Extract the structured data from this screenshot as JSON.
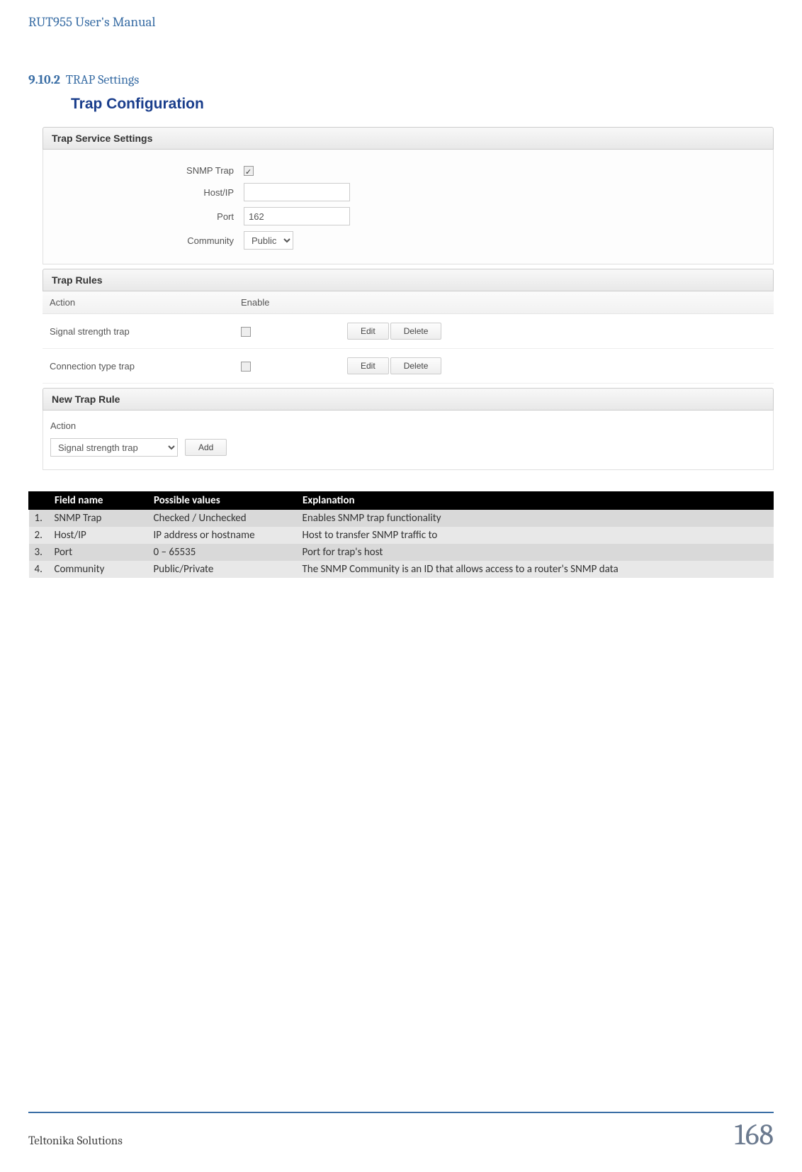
{
  "doc_title": "RUT955 User's Manual",
  "section": {
    "num": "9.10.2",
    "title": "TRAP Settings"
  },
  "ui": {
    "title": "Trap Configuration",
    "service_panel": {
      "header": "Trap Service Settings",
      "rows": {
        "snmp_trap_label": "SNMP Trap",
        "snmp_trap_checked": true,
        "host_label": "Host/IP",
        "host_value": "",
        "port_label": "Port",
        "port_value": "162",
        "community_label": "Community",
        "community_value": "Public"
      }
    },
    "rules_panel": {
      "header": "Trap Rules",
      "col_action": "Action",
      "col_enable": "Enable",
      "rows": [
        {
          "name": "Signal strength trap",
          "edit": "Edit",
          "delete": "Delete"
        },
        {
          "name": "Connection type trap",
          "edit": "Edit",
          "delete": "Delete"
        }
      ]
    },
    "new_rule": {
      "header": "New Trap Rule",
      "col_action": "Action",
      "select_value": "Signal strength trap",
      "add_label": "Add"
    }
  },
  "table": {
    "headers": {
      "num": "",
      "field": "Field name",
      "values": "Possible values",
      "expl": "Explanation"
    },
    "rows": [
      {
        "n": "1.",
        "f": "SNMP Trap",
        "v": "Checked / Unchecked",
        "e": "Enables SNMP trap functionality"
      },
      {
        "n": "2.",
        "f": "Host/IP",
        "v": "IP address or hostname",
        "e": "Host to transfer SNMP traffic to"
      },
      {
        "n": "3.",
        "f": "Port",
        "v": "0 – 65535",
        "e": "Port for trap's host"
      },
      {
        "n": "4.",
        "f": "Community",
        "v": "Public/Private",
        "e": "The SNMP Community is an ID that allows access to a router's SNMP data"
      }
    ]
  },
  "footer": {
    "left": "Teltonika Solutions",
    "right": "168"
  }
}
